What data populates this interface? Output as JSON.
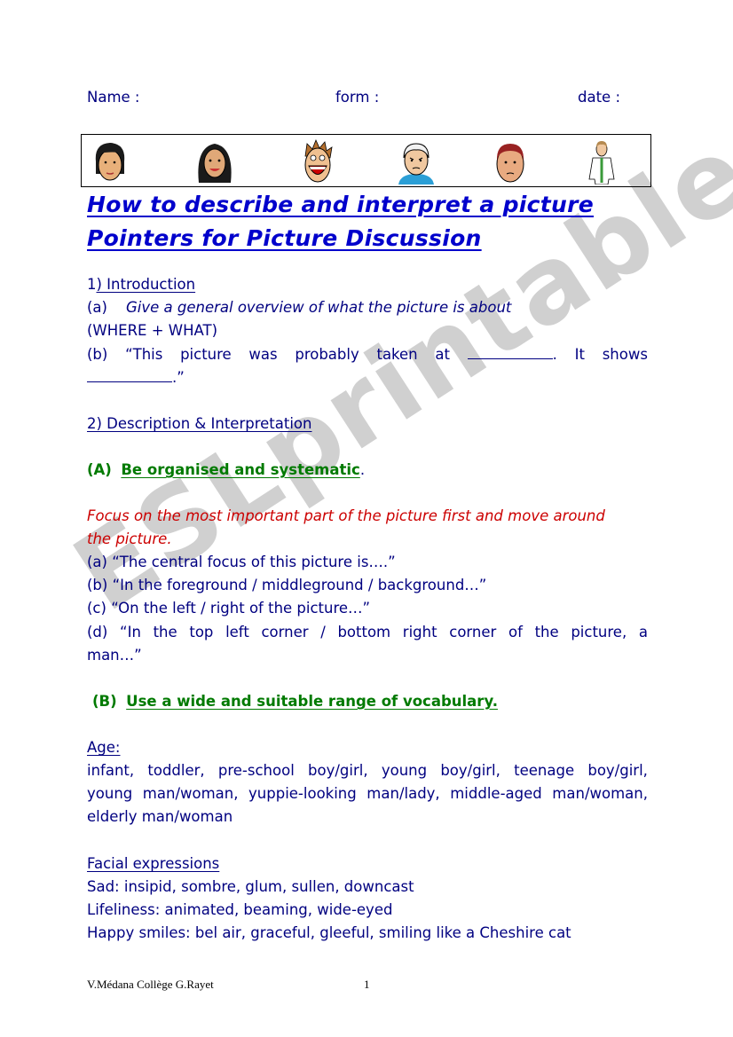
{
  "header": {
    "name_label": "Name :",
    "form_label": "form :",
    "date_label": "date :"
  },
  "faces": [
    {
      "icon": "woman-bob-hair-face-icon"
    },
    {
      "icon": "woman-long-hair-face-icon"
    },
    {
      "icon": "laughing-boy-face-icon"
    },
    {
      "icon": "elderly-man-face-icon"
    },
    {
      "icon": "red-hair-man-face-icon"
    },
    {
      "icon": "doctor-figure-icon"
    }
  ],
  "title": {
    "line1": "How to describe and interpret a picture",
    "line2": "Pointers for Picture Discussion"
  },
  "section1": {
    "heading_num": "1",
    "heading_text": ")  Introduction",
    "a_label": "(a)",
    "a_text": "Give a general overview of what the picture is about",
    "a_note": "(WHERE + WHAT)",
    "b_words": [
      "(b)",
      "“This",
      "picture",
      "was",
      "probably",
      "taken",
      "at"
    ],
    "b_after_blank": ".",
    "b_end": [
      "It",
      "shows"
    ],
    "b_line2_end": ".”"
  },
  "section2": {
    "heading": "2)  Description & Interpretation",
    "A_label": "(A)",
    "A_text": "Be organised and systematic",
    "A_period": ".",
    "focus_line1": "Focus on the most important part of the picture first and move around",
    "focus_line2": "the picture.",
    "items": [
      "(a)  “The central focus of this picture is….”",
      "(b)  “In the foreground / middleground / background…”",
      "(c)  “On the left / right of the picture…”"
    ],
    "d_words": [
      "(d)",
      "“In",
      "the",
      "top",
      "left",
      "corner",
      "/",
      "bottom",
      "right",
      "corner",
      "of",
      "the",
      "picture,",
      "a"
    ],
    "d_line2": "man…”",
    "B_label": "(B)",
    "B_text": "Use a wide and suitable range of vocabulary."
  },
  "age": {
    "heading": "Age:",
    "line1": [
      "infant,",
      "toddler,",
      "pre-school",
      "boy/girl,",
      "young",
      "boy/girl,",
      "teenage",
      "boy/girl,"
    ],
    "line2": [
      "young",
      "man/woman,",
      "yuppie-looking",
      "man/lady,",
      "middle-aged",
      "man/woman,"
    ],
    "line3": "elderly man/woman"
  },
  "facial": {
    "heading": "Facial expressions",
    "sad": "Sad: insipid, sombre, glum, sullen, downcast",
    "lifeliness": "Lifeliness: animated, beaming, wide-eyed",
    "happy": "Happy smiles: bel air, graceful, gleeful, smiling like a Cheshire cat"
  },
  "footer": {
    "author": "V.Médana Collège G.Rayet",
    "page": "1"
  },
  "watermark": "ESLprintables.com",
  "colors": {
    "text": "#000080",
    "title": "#0000cc",
    "green": "#007a00",
    "red": "#cc0000",
    "watermark": "#c8c8c8"
  }
}
